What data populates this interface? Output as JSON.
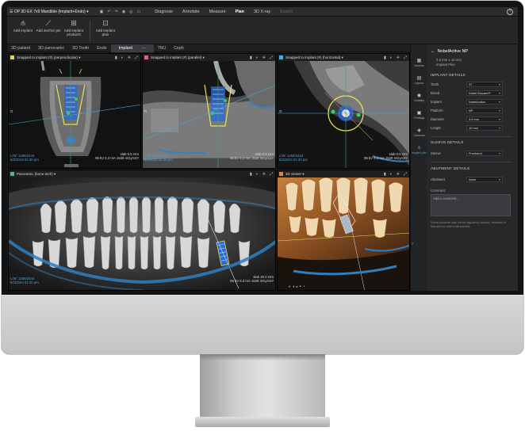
{
  "titlebar": {
    "menu_label": "OP 3D EX 7x9 Mandible (Implant+Endo)",
    "tabs": [
      "Diagnose",
      "Annotate",
      "Measure",
      "Plan",
      "3D X-ray",
      "Export"
    ],
    "active_tab": "Plan",
    "help_label": "?"
  },
  "toolbar": {
    "tools": [
      {
        "label": "Add implant",
        "icon": "implant-icon"
      },
      {
        "label": "Add anchor pin",
        "icon": "anchor-pin-icon"
      },
      {
        "label": "Add implant products",
        "icon": "implant-products-icon"
      },
      {
        "label": "Add implant plan",
        "icon": "implant-plan-icon"
      }
    ]
  },
  "view_tabs": [
    "3D patient",
    "3D panoramic",
    "3D Tooth",
    "Endo",
    "Implant",
    "TMJ",
    "Ceph"
  ],
  "active_view_tab": "Implant",
  "viewports": {
    "perpendicular": {
      "title": "Snapped to implant (#) (perpendicular)",
      "color": "#e8d25a",
      "left_marker": "O",
      "lw": "L/W: 1268/2444",
      "date": "8/2/2024 01:30 pm",
      "slab": "slab 0.5 mm",
      "exposure": "95 kV 6.3 mA 1528 mGy/cm²"
    },
    "parallel": {
      "title": "Snapped to implant (#) (parallel)",
      "color": "#d06a7a",
      "lw": "L/W: 1268/2444",
      "date": "8/2/2024 01:30 pm",
      "slab": "slab 0.5 mm",
      "exposure": "95 kV 6.3 mA 1528 mGy/cm²"
    },
    "horizontal": {
      "title": "Snapped to implant (#) (horizontal)",
      "color": "#5aa8d8",
      "left_marker": "O",
      "lw": "L/W: 1268/3444",
      "date": "8/2/2024 01:30 pm",
      "slab": "slab 0.5 mm",
      "exposure": "95 kV 6.3 mA 1528 mGy/cm²"
    },
    "panoramic": {
      "title": "Panoramic (bone arch)",
      "color": "#4cbf6a",
      "lw": "L/W: 1268/2444",
      "date": "8/2/2024 01:30 pm",
      "slab": "slab 20.0 mm",
      "exposure": "95 kV 6.3 mA 1528 mGy/cm²"
    },
    "viewer3d": {
      "title": "3D viewer",
      "color": "#e0863a"
    }
  },
  "right_strip": [
    {
      "label": "Viewers",
      "icon": "viewers-icon"
    },
    {
      "label": "Layout",
      "icon": "layout-icon"
    },
    {
      "label": "Visibility",
      "icon": "eye-icon"
    },
    {
      "label": "Findings",
      "icon": "findings-icon"
    },
    {
      "label": "Cameras",
      "icon": "camera-icon"
    },
    {
      "label": "Implant plan",
      "icon": "implant-plan-icon",
      "active": true
    }
  ],
  "panel": {
    "back_label": "←",
    "title": "NobelActive NP",
    "subtitle": "3.5 mm x 10 mm",
    "subtitle2": "Implant Plan",
    "implant_details_header": "IMPLANT DETAILS",
    "fields": [
      {
        "label": "Tooth",
        "value": "37"
      },
      {
        "label": "Brand",
        "value": "Nobel Biocare®"
      },
      {
        "label": "Implant",
        "value": "NobelActive"
      },
      {
        "label": "Platform",
        "value": "NP"
      },
      {
        "label": "Diameter",
        "value": "3.5 mm"
      },
      {
        "label": "Length",
        "value": "10 mm"
      }
    ],
    "sleeve_header": "SLEEVE DETAILS",
    "sleeve": {
      "label": "Sleeve",
      "value": "Freehand"
    },
    "abutment_header": "ABUTMENT DETAILS",
    "abutment": {
      "label": "Abutment",
      "value": "None"
    },
    "comment_label": "Comment",
    "comment_placeholder": "Add a comment...",
    "disclaimer": "Some products may not be regulatory cleared, released or licensed for sale in all markets."
  },
  "colors": {
    "accent": "#4aa6d6",
    "implant_line": "#e8e25a",
    "bone_annotation": "#2f7fc0"
  }
}
